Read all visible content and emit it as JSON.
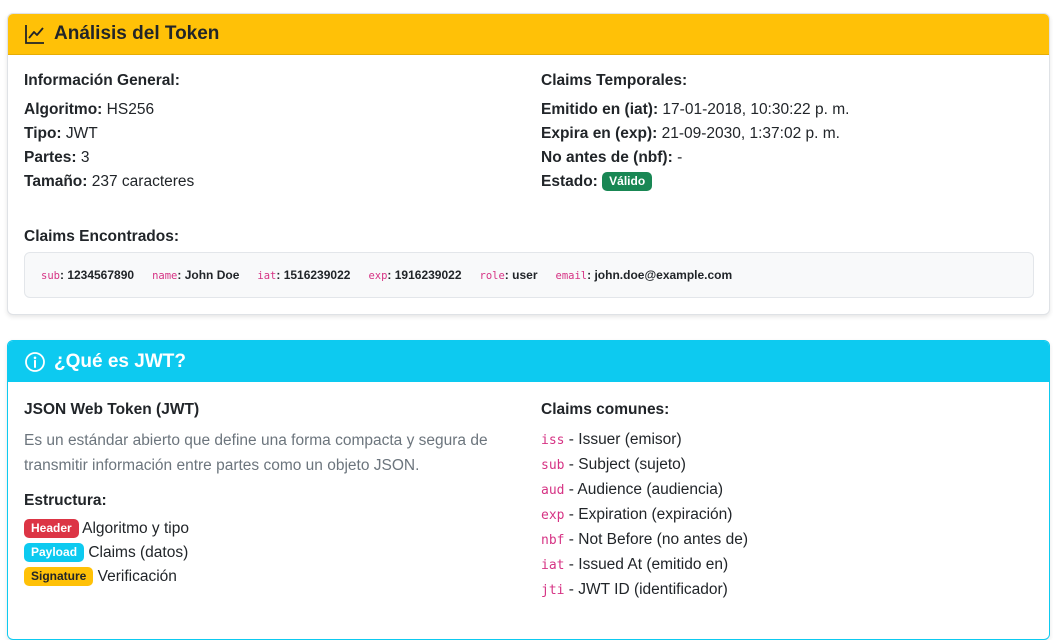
{
  "analysis": {
    "title": "Análisis del Token",
    "general": {
      "heading": "Información General:",
      "algorithm_label": "Algoritmo:",
      "algorithm_value": "HS256",
      "type_label": "Tipo:",
      "type_value": "JWT",
      "parts_label": "Partes:",
      "parts_value": "3",
      "size_label": "Tamaño:",
      "size_value": "237 caracteres"
    },
    "temporal": {
      "heading": "Claims Temporales:",
      "iat_label": "Emitido en (iat):",
      "iat_value": "17-01-2018, 10:30:22 p. m.",
      "exp_label": "Expira en (exp):",
      "exp_value": "21-09-2030, 1:37:02 p. m.",
      "nbf_label": "No antes de (nbf):",
      "nbf_value": "-",
      "status_label": "Estado:",
      "status_badge": "Válido"
    },
    "claims_found": {
      "heading": "Claims Encontrados:",
      "items": [
        {
          "key": "sub",
          "value": "1234567890"
        },
        {
          "key": "name",
          "value": "John Doe"
        },
        {
          "key": "iat",
          "value": "1516239022"
        },
        {
          "key": "exp",
          "value": "1916239022"
        },
        {
          "key": "role",
          "value": "user"
        },
        {
          "key": "email",
          "value": "john.doe@example.com"
        }
      ]
    }
  },
  "about": {
    "title": "¿Qué es JWT?",
    "left": {
      "heading": "JSON Web Token (JWT)",
      "description": "Es un estándar abierto que define una forma compacta y segura de transmitir información entre partes como un objeto JSON.",
      "structure_heading": "Estructura:",
      "parts": [
        {
          "badge": "Header",
          "text": "Algoritmo y tipo",
          "color": "#dc3545"
        },
        {
          "badge": "Payload",
          "text": "Claims (datos)",
          "color": "#0dcaf0"
        },
        {
          "badge": "Signature",
          "text": "Verificación",
          "color": "#ffc107"
        }
      ]
    },
    "right": {
      "heading": "Claims comunes:",
      "items": [
        {
          "code": "iss",
          "text": " - Issuer (emisor)"
        },
        {
          "code": "sub",
          "text": " - Subject (sujeto)"
        },
        {
          "code": "aud",
          "text": " - Audience (audiencia)"
        },
        {
          "code": "exp",
          "text": " - Expiration (expiración)"
        },
        {
          "code": "nbf",
          "text": " - Not Before (no antes de)"
        },
        {
          "code": "iat",
          "text": " - Issued At (emitido en)"
        },
        {
          "code": "jti",
          "text": " - JWT ID (identificador)"
        }
      ]
    }
  },
  "icons": {
    "analysis": "chart-line-icon",
    "about": "info-circle-icon"
  }
}
